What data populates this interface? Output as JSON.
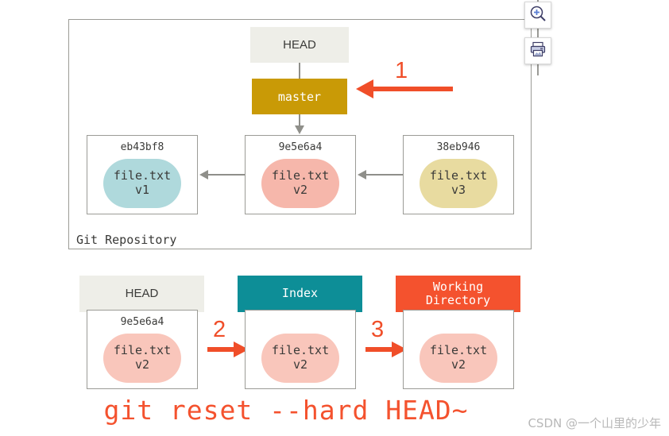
{
  "diagram": {
    "title_caption": "git reset --hard HEAD~",
    "repository": {
      "frame_label": "Git Repository",
      "head_label": "HEAD",
      "branch_label": "master",
      "commits": [
        {
          "sha": "eb43bf8",
          "file": "file.txt",
          "version": "v1",
          "color": "#afd9dc"
        },
        {
          "sha": "9e5e6a4",
          "file": "file.txt",
          "version": "v2",
          "color": "#f6b7ab"
        },
        {
          "sha": "38eb946",
          "file": "file.txt",
          "version": "v3",
          "color": "#e8dba0"
        }
      ]
    },
    "stages": [
      {
        "header": "HEAD",
        "sha": "9e5e6a4",
        "file": "file.txt",
        "version": "v2",
        "header_color": "#eeeee8",
        "blob_color": "#f9c6bb"
      },
      {
        "header": "Index",
        "sha": "",
        "file": "file.txt",
        "version": "v2",
        "header_color": "#0d8e97",
        "blob_color": "#f9c6bb"
      },
      {
        "header_line1": "Working",
        "header_line2": "Directory",
        "sha": "",
        "file": "file.txt",
        "version": "v2",
        "header_color": "#f4522e",
        "blob_color": "#f9c6bb"
      }
    ],
    "steps": [
      {
        "number": "1"
      },
      {
        "number": "2"
      },
      {
        "number": "3"
      }
    ]
  },
  "toolbar": {
    "zoom_in_title": "Zoom in",
    "print_title": "Print"
  },
  "watermark": {
    "text": "CSDN @一个山里的少年"
  },
  "colors": {
    "accent_red": "#f04e29",
    "branch_gold": "#c99a06",
    "index_teal": "#0d8e97",
    "working_orange": "#f4522e",
    "line_gray": "#8f8f8a"
  }
}
